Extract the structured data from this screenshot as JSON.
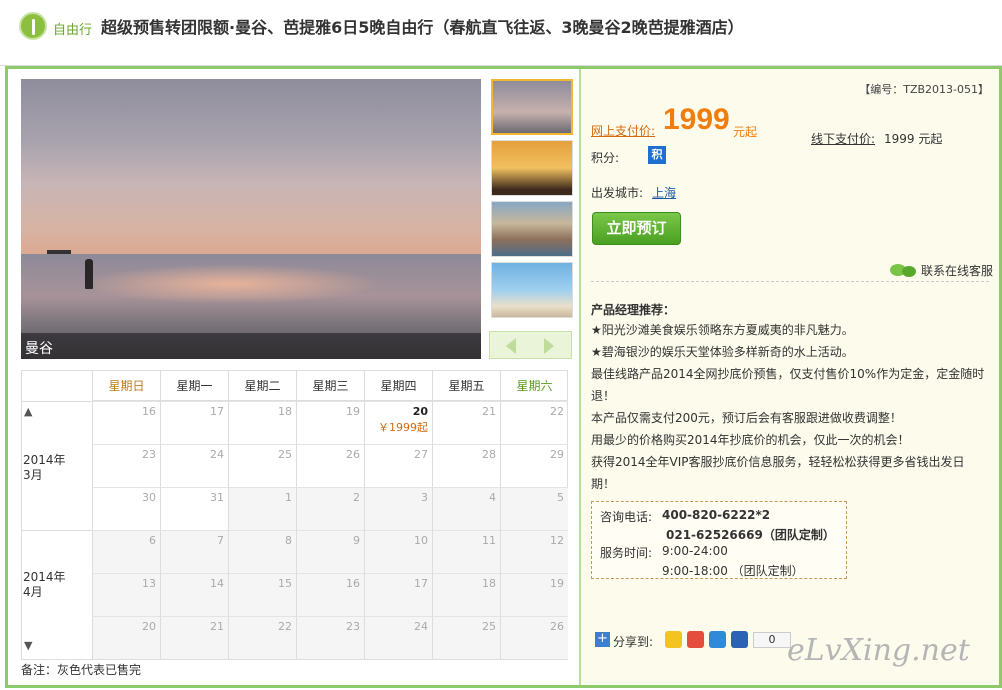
{
  "header": {
    "badge": "自由行",
    "title": "超级预售转团限额·曼谷、芭提雅6日5晚自由行（春航直飞往返、3晚曼谷2晚芭提雅酒店）"
  },
  "gallery": {
    "caption": "曼谷"
  },
  "calendar": {
    "weekdays": [
      "星期日",
      "星期一",
      "星期二",
      "星期三",
      "星期四",
      "星期五",
      "星期六"
    ],
    "months": [
      {
        "label": "2014年\n3月"
      },
      {
        "label": "2014年\n4月"
      }
    ],
    "weeks": [
      [
        "16",
        "17",
        "18",
        "19",
        "20",
        "21",
        "22"
      ],
      [
        "23",
        "24",
        "25",
        "26",
        "27",
        "28",
        "29"
      ],
      [
        "30",
        "31",
        "1",
        "2",
        "3",
        "4",
        "5"
      ],
      [
        "6",
        "7",
        "8",
        "9",
        "10",
        "11",
        "12"
      ],
      [
        "13",
        "14",
        "15",
        "16",
        "17",
        "18",
        "19"
      ],
      [
        "20",
        "21",
        "22",
        "23",
        "24",
        "25",
        "26"
      ]
    ],
    "highlight_price": "￥1999起",
    "up_arrow": "▲",
    "down_arrow": "▼",
    "note": "备注：灰色代表已售完"
  },
  "product": {
    "code": "【编号：TZB2013-051】",
    "online_label": "网上支付价:",
    "price": "1999",
    "price_suffix": "元起",
    "offline_label": "线下支付价:",
    "offline_value": "1999 元起",
    "points_label": "积分:",
    "points_icon": "积",
    "city_label": "出发城市:",
    "city": "上海",
    "book_button": "立即预订",
    "chat": "联系在线客服"
  },
  "recommend": {
    "title": "产品经理推荐：",
    "items": [
      "★阳光沙滩美食娱乐领略东方夏威夷的非凡魅力。",
      "★碧海银沙的娱乐天堂体验多样新奇的水上活动。",
      "最佳线路产品2014全网抄底价预售，仅支付售价10%作为定金，定金随时退！",
      "本产品仅需支付200元，预订后会有客服跟进做收费调整！",
      "用最少的价格购买2014年抄底价的机会，仅此一次的机会！",
      "获得2014全年VIP客服抄底价信息服务，轻轻松松获得更多省钱出发日期！"
    ]
  },
  "contact": {
    "phone_label": "咨询电话:",
    "phone1": "400-820-6222*2",
    "phone2": "021-62526669（团队定制）",
    "hours_label": "服务时间:",
    "hours1": "9:00-24:00",
    "hours2": "9:00-18:00 （团队定制）"
  },
  "share": {
    "label": "分享到:",
    "count": "0"
  },
  "watermark": "eLvXing.net",
  "colors": {
    "accent_green": "#8dca6a",
    "price_orange": "#f07d0d",
    "button_green": "#4aa021"
  }
}
